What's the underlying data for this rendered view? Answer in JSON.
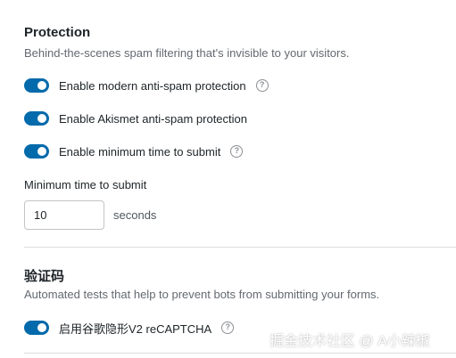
{
  "protection": {
    "title": "Protection",
    "description": "Behind-the-scenes spam filtering that's invisible to your visitors.",
    "toggles": [
      {
        "label": "Enable modern anti-spam protection",
        "enabled": true,
        "has_help": true
      },
      {
        "label": "Enable Akismet anti-spam protection",
        "enabled": true,
        "has_help": false
      },
      {
        "label": "Enable minimum time to submit",
        "enabled": true,
        "has_help": true
      }
    ],
    "min_time": {
      "label": "Minimum time to submit",
      "value": "10",
      "unit": "seconds"
    }
  },
  "captcha": {
    "title": "验证码",
    "description": "Automated tests that help to prevent bots from submitting your forms.",
    "toggles": [
      {
        "label": "启用谷歌隐形V2 reCAPTCHA",
        "enabled": true,
        "has_help": true
      }
    ]
  },
  "help_glyph": "?",
  "watermark": "掘金技术社区 @ A小辣椒",
  "colors": {
    "toggle_on": "#036aab",
    "title": "#1d2327",
    "description": "#646970"
  }
}
